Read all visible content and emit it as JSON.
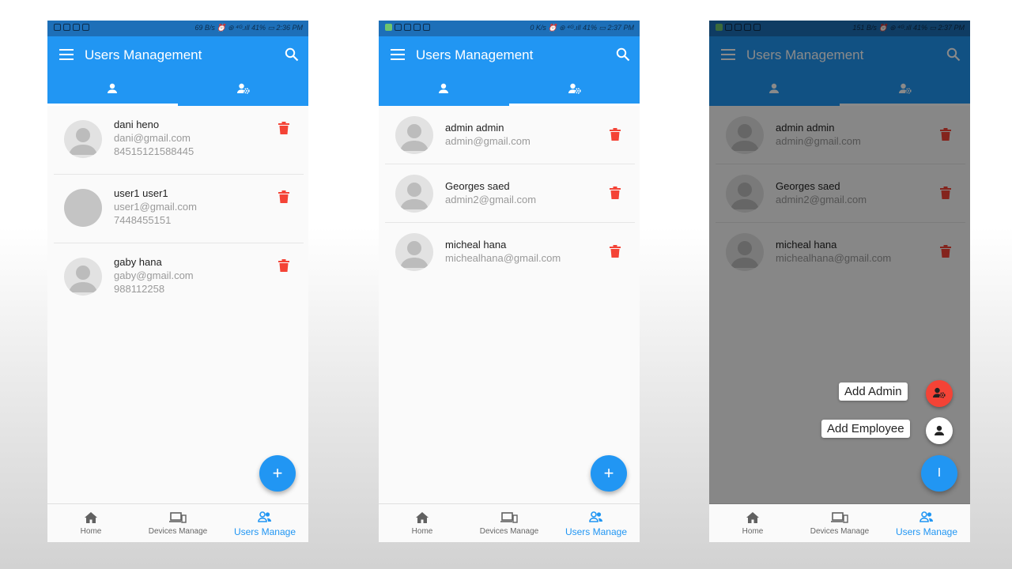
{
  "colors": {
    "primary": "#2196f3",
    "danger": "#f44336",
    "status_bar": "#1d6fb8"
  },
  "screens": [
    {
      "status_bar": {
        "left_icons": [
          "check-icon",
          "whatsapp-icon",
          "mail-icon",
          "app-icon"
        ],
        "right": "69 B/s ⏰ ⊛ ⁴ᴳ.ıll 41% ▭ 2:36 PM"
      },
      "app_bar": {
        "title": "Users Management",
        "search_icon": "search-icon",
        "menu_icon": "menu-icon"
      },
      "tabs": [
        {
          "icon": "person-icon",
          "active": true
        },
        {
          "icon": "admin-settings-icon",
          "active": false
        }
      ],
      "users": [
        {
          "name": "dani heno",
          "email": "dani@gmail.com",
          "phone": "84515121588445"
        },
        {
          "name": "user1 user1",
          "email": "user1@gmail.com",
          "phone": "7448455151"
        },
        {
          "name": "gaby hana",
          "email": "gaby@gmail.com",
          "phone": "988112258"
        }
      ],
      "fab": "+",
      "bottom_nav": [
        {
          "label": "Home",
          "icon": "home-icon"
        },
        {
          "label": "Devices Manage",
          "icon": "devices-icon"
        },
        {
          "label": "Users Manage",
          "icon": "users-icon",
          "active": true
        }
      ]
    },
    {
      "status_bar": {
        "right": "0 K/s ⏰ ⊛ ⁴ᴳ.ıll 41% ▭ 2:37 PM"
      },
      "app_bar": {
        "title": "Users Management"
      },
      "tabs": [
        {
          "icon": "person-icon",
          "active": false
        },
        {
          "icon": "admin-settings-icon",
          "active": true
        }
      ],
      "users": [
        {
          "name": "admin admin",
          "email": "admin@gmail.com"
        },
        {
          "name": "Georges saed",
          "email": "admin2@gmail.com"
        },
        {
          "name": "micheal hana",
          "email": "michealhana@gmail.com"
        }
      ],
      "fab": "+",
      "bottom_nav": [
        {
          "label": "Home"
        },
        {
          "label": "Devices Manage"
        },
        {
          "label": "Users Manage",
          "active": true
        }
      ]
    },
    {
      "status_bar": {
        "right": "151 B/s ⏰ ⊛ ⁴ᴳ.ıll 41% ▭ 2:37 PM"
      },
      "app_bar": {
        "title": "Users Management"
      },
      "users": [
        {
          "name": "admin admin",
          "email": "admin@gmail.com"
        },
        {
          "name": "Georges saed",
          "email": "admin2@gmail.com"
        },
        {
          "name": "micheal hana",
          "email": "michealhana@gmail.com"
        }
      ],
      "speed_dial": {
        "add_admin_label": "Add Admin",
        "add_employee_label": "Add Employee",
        "main_fab": "I"
      },
      "bottom_nav": [
        {
          "label": "Home"
        },
        {
          "label": "Devices Manage"
        },
        {
          "label": "Users Manage",
          "active": true
        }
      ]
    }
  ]
}
